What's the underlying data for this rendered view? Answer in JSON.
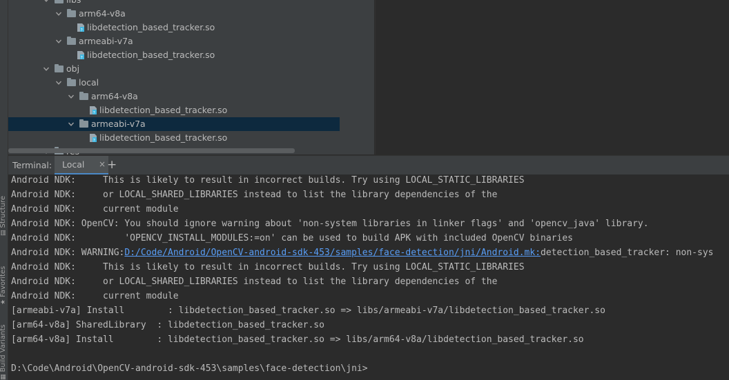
{
  "sidebar": {
    "tabs": [
      {
        "label": "Structure",
        "icon": "structure-icon"
      },
      {
        "label": "Favorites",
        "icon": "star-icon"
      },
      {
        "label": "Build Variants",
        "icon": "build-variants-icon"
      }
    ]
  },
  "tree": {
    "rows": [
      {
        "label": "libs",
        "type": "folder",
        "level": 3
      },
      {
        "label": "arm64-v8a",
        "type": "folder",
        "level": 4
      },
      {
        "label": "libdetection_based_tracker.so",
        "type": "file",
        "level": 5
      },
      {
        "label": "armeabi-v7a",
        "type": "folder",
        "level": 4
      },
      {
        "label": "libdetection_based_tracker.so",
        "type": "file",
        "level": 5
      },
      {
        "label": "obj",
        "type": "folder",
        "level": 3
      },
      {
        "label": "local",
        "type": "folder",
        "level": 4
      },
      {
        "label": "arm64-v8a",
        "type": "folder",
        "level": 5
      },
      {
        "label": "libdetection_based_tracker.so",
        "type": "file",
        "level": 6
      },
      {
        "label": "armeabi-v7a",
        "type": "folder",
        "level": 5,
        "selected": true
      },
      {
        "label": "libdetection_based_tracker.so",
        "type": "file",
        "level": 6
      },
      {
        "label": "res",
        "type": "folder",
        "level": 3
      }
    ]
  },
  "terminal": {
    "title": "Terminal:",
    "tab_label": "Local",
    "close_glyph": "×",
    "add_glyph": "+",
    "lines": [
      {
        "text": "Android NDK:     This is likely to result in incorrect builds. Try using LOCAL_STATIC_LIBRARIES"
      },
      {
        "text": "Android NDK:     or LOCAL_SHARED_LIBRARIES instead to list the library dependencies of the"
      },
      {
        "text": "Android NDK:     current module"
      },
      {
        "text": "Android NDK: OpenCV: You should ignore warning about 'non-system libraries in linker flags' and 'opencv_java' library."
      },
      {
        "text": "Android NDK:         'OPENCV_INSTALL_MODULES:=on' can be used to build APK with included OpenCV binaries"
      },
      {
        "text": "Android NDK: WARNING:",
        "link": "D:/Code/Android/OpenCV-android-sdk-453/samples/face-detection/jni/Android.mk:",
        "rest": "detection_based_tracker: non-sys"
      },
      {
        "text": "Android NDK:     This is likely to result in incorrect builds. Try using LOCAL_STATIC_LIBRARIES"
      },
      {
        "text": "Android NDK:     or LOCAL_SHARED_LIBRARIES instead to list the library dependencies of the"
      },
      {
        "text": "Android NDK:     current module"
      },
      {
        "text": "[armeabi-v7a] Install        : libdetection_based_tracker.so => libs/armeabi-v7a/libdetection_based_tracker.so"
      },
      {
        "text": "[arm64-v8a] SharedLibrary  : libdetection_based_tracker.so"
      },
      {
        "text": "[arm64-v8a] Install        : libdetection_based_tracker.so => libs/arm64-v8a/libdetection_based_tracker.so"
      },
      {
        "text": ""
      },
      {
        "text": "D:\\Code\\Android\\OpenCV-android-sdk-453\\samples\\face-detection\\jni>"
      }
    ]
  },
  "colors": {
    "panel": "#3c3f41",
    "background": "#2b2b2b",
    "selection": "#0d293e",
    "link": "#589df6",
    "accent": "#4a88c7",
    "text": "#bbbbbb"
  }
}
